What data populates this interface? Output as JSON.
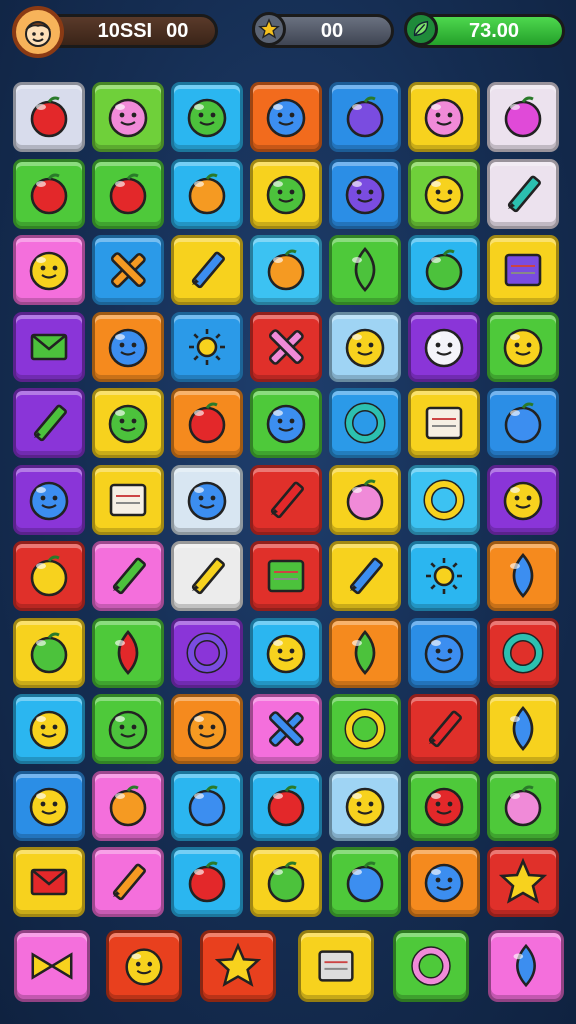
{
  "hud": {
    "score_left": "10SSI",
    "score_right": "00",
    "stars_value": "00",
    "leaves_value": "73.00"
  },
  "board": {
    "rows": [
      [
        {
          "color": "#d8dcec",
          "icon": "red-ball-icon"
        },
        {
          "color": "#6fd03a",
          "icon": "pink-blob-icon"
        },
        {
          "color": "#2bb6f0",
          "icon": "green-bubble-icon"
        },
        {
          "color": "#f26b1d",
          "icon": "blue-face-icon"
        },
        {
          "color": "#2b8ee6",
          "icon": "purple-ball-icon"
        },
        {
          "color": "#f7d21e",
          "icon": "pink-bubble-icon"
        },
        {
          "color": "#ece2ee",
          "icon": "magenta-fruit-icon"
        }
      ],
      [
        {
          "color": "#4ec93a",
          "icon": "red-apple-icon"
        },
        {
          "color": "#4ec93a",
          "icon": "red-ball-icon"
        },
        {
          "color": "#2bb6f0",
          "icon": "orange-fruit-icon"
        },
        {
          "color": "#f7d21e",
          "icon": "green-blob-icon"
        },
        {
          "color": "#2b8ee6",
          "icon": "purple-blob-icon"
        },
        {
          "color": "#6fd03a",
          "icon": "yellow-face-icon"
        },
        {
          "color": "#ece2ee",
          "icon": "teal-pen-icon"
        }
      ],
      [
        {
          "color": "#f46fdc",
          "icon": "yellow-face-icon"
        },
        {
          "color": "#2b9ae8",
          "icon": "orange-cross-icon"
        },
        {
          "color": "#f7d21e",
          "icon": "blue-ruler-icon"
        },
        {
          "color": "#3cc2f2",
          "icon": "orange-egg-icon"
        },
        {
          "color": "#4ec93a",
          "icon": "green-pickle-icon"
        },
        {
          "color": "#2bb6f0",
          "icon": "green-ball-icon"
        },
        {
          "color": "#f7d21e",
          "icon": "purple-card-icon"
        }
      ],
      [
        {
          "color": "#8a35d8",
          "icon": "green-envelope-icon"
        },
        {
          "color": "#f58a1e",
          "icon": "blue-blob-icon"
        },
        {
          "color": "#2b9ae8",
          "icon": "yellow-sun-icon"
        },
        {
          "color": "#e0302a",
          "icon": "pink-cross-icon"
        },
        {
          "color": "#9fd4f4",
          "icon": "yellow-face-icon"
        },
        {
          "color": "#8a35d8",
          "icon": "white-ghost-icon"
        },
        {
          "color": "#4ec93a",
          "icon": "yellow-face-icon"
        }
      ],
      [
        {
          "color": "#8a35d8",
          "icon": "green-pencil-icon"
        },
        {
          "color": "#f7d21e",
          "icon": "green-face-icon"
        },
        {
          "color": "#f58a1e",
          "icon": "red-ball-icon"
        },
        {
          "color": "#4ec93a",
          "icon": "blue-face-icon"
        },
        {
          "color": "#2b9ae8",
          "icon": "teal-swirl-icon"
        },
        {
          "color": "#f7d21e",
          "icon": "notepad-icon"
        },
        {
          "color": "#2b8ee6",
          "icon": "blue-apple-icon"
        }
      ],
      [
        {
          "color": "#8a35d8",
          "icon": "blue-ghost-icon"
        },
        {
          "color": "#f7d21e",
          "icon": "calendar-icon"
        },
        {
          "color": "#d8e6f2",
          "icon": "blue-blob-icon"
        },
        {
          "color": "#e0302a",
          "icon": "red-pencil-icon"
        },
        {
          "color": "#f7d21e",
          "icon": "pink-fruit-icon"
        },
        {
          "color": "#3cc2f2",
          "icon": "yellow-snail-icon"
        },
        {
          "color": "#8a35d8",
          "icon": "yellow-face-icon"
        }
      ],
      [
        {
          "color": "#e0302a",
          "icon": "yellow-lemon-icon"
        },
        {
          "color": "#f46fdc",
          "icon": "green-marker-icon"
        },
        {
          "color": "#ececec",
          "icon": "yellow-pencil-icon"
        },
        {
          "color": "#e0302a",
          "icon": "green-square-icon"
        },
        {
          "color": "#f7d21e",
          "icon": "blue-pencil-icon"
        },
        {
          "color": "#2bb6f0",
          "icon": "yellow-sun-icon"
        },
        {
          "color": "#f58a1e",
          "icon": "blue-kite-icon"
        }
      ],
      [
        {
          "color": "#f7d21e",
          "icon": "green-ball-icon"
        },
        {
          "color": "#4ec93a",
          "icon": "red-racket-icon"
        },
        {
          "color": "#8a35d8",
          "icon": "purple-ring-icon"
        },
        {
          "color": "#2bb6f0",
          "icon": "yellow-face-icon"
        },
        {
          "color": "#f58a1e",
          "icon": "green-cactus-icon"
        },
        {
          "color": "#2b8ee6",
          "icon": "blue-face-icon"
        },
        {
          "color": "#e0302a",
          "icon": "teal-target-icon"
        }
      ],
      [
        {
          "color": "#2bb6f0",
          "icon": "yellow-face-icon"
        },
        {
          "color": "#4ec93a",
          "icon": "green-face-icon"
        },
        {
          "color": "#f58a1e",
          "icon": "orange-face-icon"
        },
        {
          "color": "#f46fdc",
          "icon": "blue-cross-icon"
        },
        {
          "color": "#4ec93a",
          "icon": "yellow-ring-icon"
        },
        {
          "color": "#e0302a",
          "icon": "red-pencil-icon"
        },
        {
          "color": "#f7d21e",
          "icon": "blue-drop-icon"
        }
      ],
      [
        {
          "color": "#2b8ee6",
          "icon": "yellow-face-icon"
        },
        {
          "color": "#f46fdc",
          "icon": "orange-fruit-icon"
        },
        {
          "color": "#2bb6f0",
          "icon": "blue-ball-icon"
        },
        {
          "color": "#2bb6f0",
          "icon": "strawberry-icon"
        },
        {
          "color": "#9fd4f4",
          "icon": "yellow-face-icon"
        },
        {
          "color": "#4ec93a",
          "icon": "red-face-icon"
        },
        {
          "color": "#4ec93a",
          "icon": "pink-ball-icon"
        }
      ],
      [
        {
          "color": "#f7d21e",
          "icon": "red-envelope-icon"
        },
        {
          "color": "#f46fdc",
          "icon": "orange-brush-icon"
        },
        {
          "color": "#2bb6f0",
          "icon": "tomato-icon"
        },
        {
          "color": "#f7d21e",
          "icon": "green-ball-icon"
        },
        {
          "color": "#4ec93a",
          "icon": "blue-fruit-icon"
        },
        {
          "color": "#f58a1e",
          "icon": "blue-blob-icon"
        },
        {
          "color": "#e0302a",
          "icon": "yellow-star-icon"
        }
      ]
    ]
  },
  "dock": {
    "items": [
      {
        "color": "#f46fdc",
        "icon": "yellow-bow-icon"
      },
      {
        "color": "#e8401e",
        "icon": "yellow-face-icon"
      },
      {
        "color": "#e8401e",
        "icon": "yellow-star-icon"
      },
      {
        "color": "#f7d21e",
        "icon": "treasure-chest-icon"
      },
      {
        "color": "#4ec93a",
        "icon": "pink-snail-icon"
      },
      {
        "color": "#f46fdc",
        "icon": "blue-pacifier-icon"
      }
    ]
  }
}
